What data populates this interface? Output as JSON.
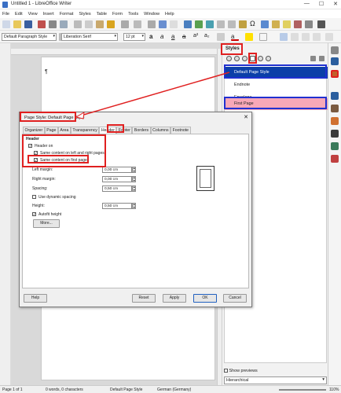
{
  "window": {
    "title": "Untitled 1 - LibreOffice Writer"
  },
  "menu": [
    "File",
    "Edit",
    "View",
    "Insert",
    "Format",
    "Styles",
    "Table",
    "Form",
    "Tools",
    "Window",
    "Help"
  ],
  "toolbar": {
    "paragraph_style": "Default Paragraph Style",
    "font_name": "Liberation Serif",
    "font_size": "12 pt"
  },
  "document": {
    "cursor": "¶"
  },
  "sidebar": {
    "title": "Styles",
    "styles": [
      "Default Page Style",
      "Endnote",
      "Envelope",
      "First Page"
    ],
    "show_previews": "Show previews",
    "filter": "Hierarchical"
  },
  "dialog": {
    "title": "Page Style: Default Page Style",
    "tabs": [
      "Organizer",
      "Page",
      "Area",
      "Transparency",
      "Header",
      "Footer",
      "Borders",
      "Columns",
      "Footnote"
    ],
    "active_tab": "Header",
    "section": "Header",
    "header_on": "Header on",
    "same_lr": "Same content on left and right pages",
    "same_first": "Same content on first page",
    "left_margin_label": "Left margin:",
    "left_margin": "0,00 cm",
    "right_margin_label": "Right margin:",
    "right_margin": "0,00 cm",
    "spacing_label": "Spacing:",
    "spacing": "0,50 cm",
    "dynamic_spacing": "Use dynamic spacing",
    "height_label": "Height:",
    "height": "0,50 cm",
    "autofit": "Autofit height",
    "more": "More...",
    "help": "Help",
    "reset": "Reset",
    "apply": "Apply",
    "ok": "OK",
    "cancel": "Cancel"
  },
  "status": {
    "page": "Page 1 of 1",
    "words": "0 words, 0 characters",
    "page_style": "Default Page Style",
    "language": "German (Germany)",
    "zoom": "110%"
  },
  "colors": {
    "accent_red": "#e02020",
    "accent_blue": "#2030d0",
    "selected_style": "#0b3fa8",
    "first_page_bg": "#f8a8b8"
  }
}
